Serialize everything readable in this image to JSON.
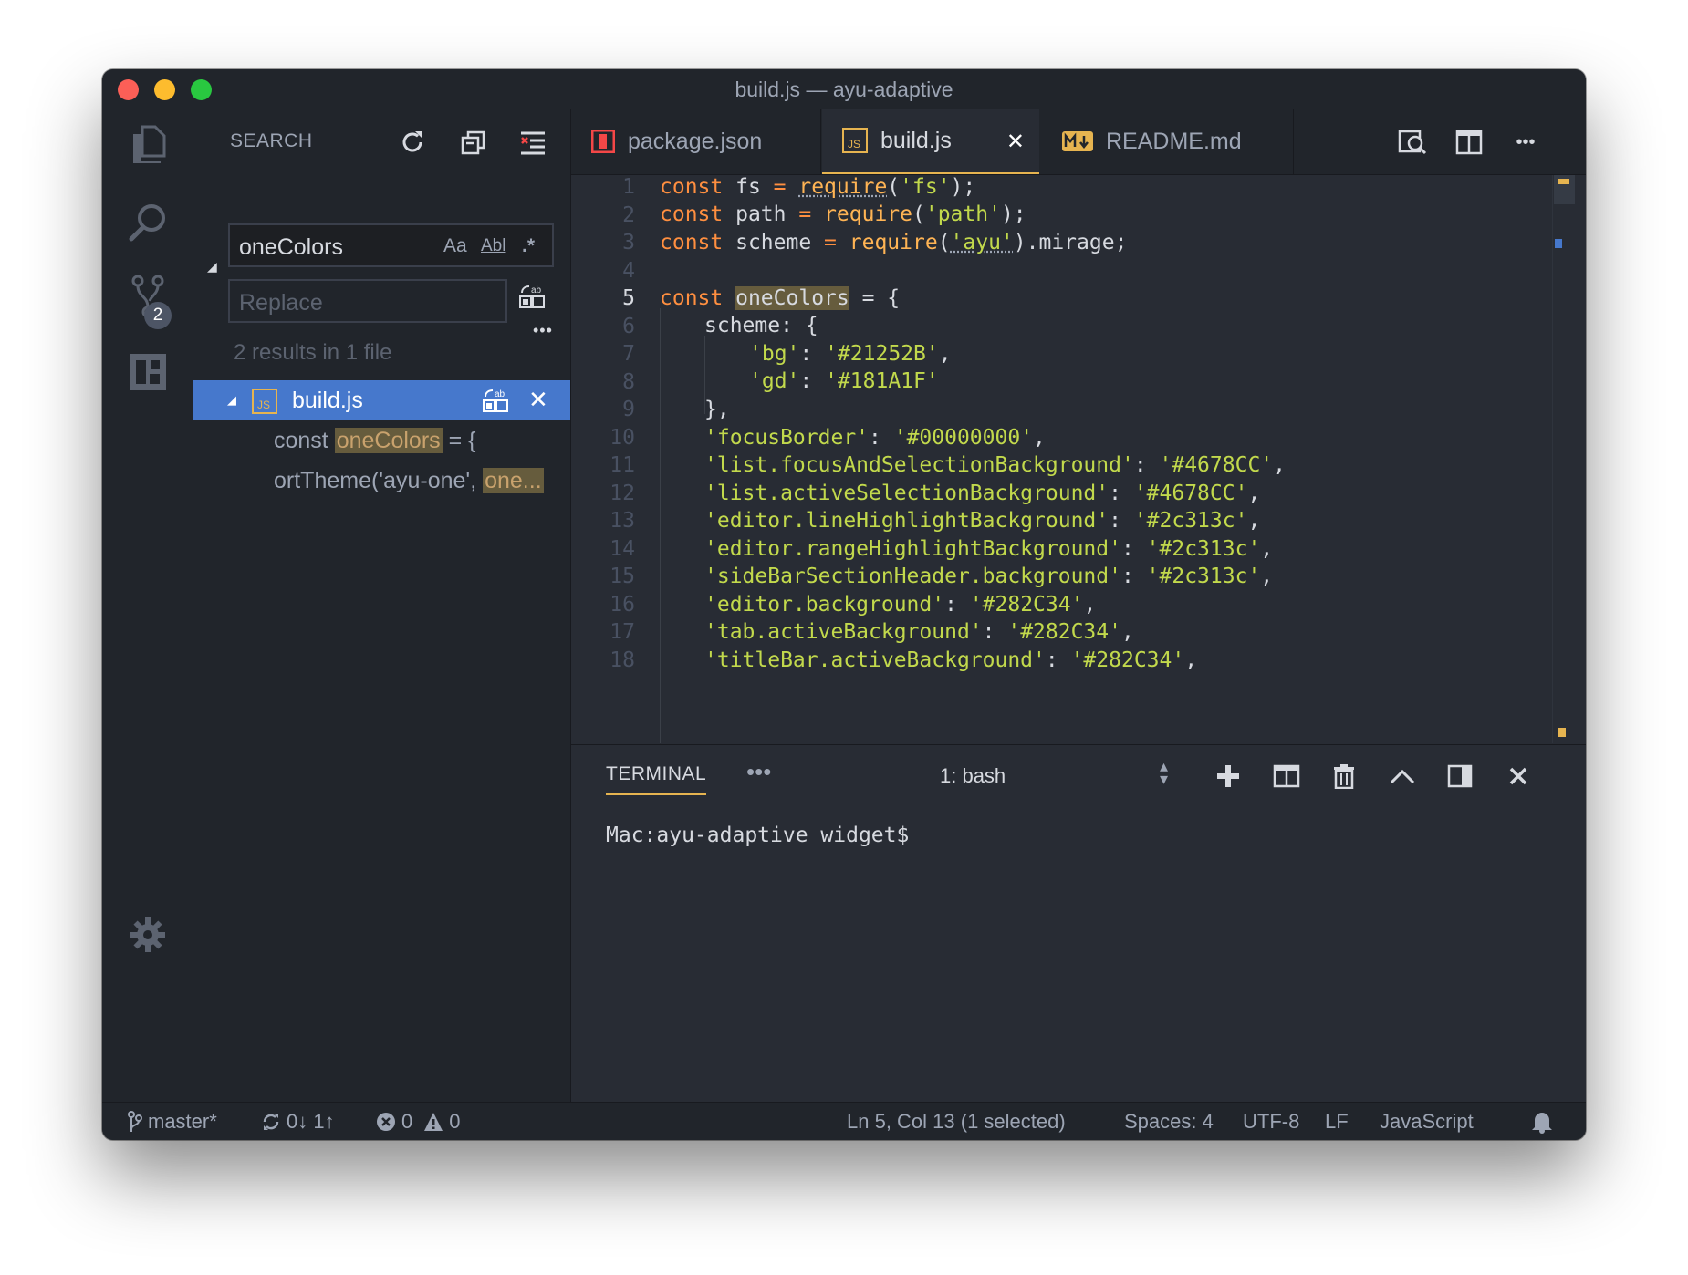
{
  "window": {
    "title": "build.js — ayu-adaptive"
  },
  "activity": {
    "scm_badge": "2"
  },
  "sidebar": {
    "title": "SEARCH",
    "search_value": "oneColors",
    "opt_case": "Aa",
    "opt_word": "Abl",
    "opt_regex": ".*",
    "replace_placeholder": "Replace",
    "results_summary": "2 results in 1 file",
    "file_result": {
      "name": "build.js"
    },
    "matches": [
      {
        "before": "const ",
        "match": "oneColors",
        "after": " = {"
      },
      {
        "before": "ortTheme('ayu-one', ",
        "match": "one...",
        "after": ""
      }
    ]
  },
  "tabs": [
    {
      "label": "package.json",
      "icon": "npm-icon"
    },
    {
      "label": "build.js",
      "icon": "js-icon",
      "close": "✕"
    },
    {
      "label": "README.md",
      "icon": "markdown-icon"
    }
  ],
  "editor": {
    "current_line": 5,
    "line_numbers": [
      "1",
      "2",
      "3",
      "4",
      "5",
      "6",
      "7",
      "8",
      "9",
      "10",
      "11",
      "12",
      "13",
      "14",
      "15",
      "16",
      "17",
      "18"
    ],
    "lines": {
      "l1": {
        "a": "const",
        "b": " fs ",
        "c": "=",
        "d": " ",
        "e": "require",
        "f": "(",
        "g": "'fs'",
        "h": ");"
      },
      "l2": {
        "a": "const",
        "b": " path ",
        "c": "=",
        "d": " ",
        "e": "require",
        "f": "(",
        "g": "'path'",
        "h": ");"
      },
      "l3": {
        "a": "const",
        "b": " scheme ",
        "c": "=",
        "d": " ",
        "e": "require",
        "f": "(",
        "g": "'ayu'",
        "h": ").mirage;"
      },
      "l5": {
        "a": "const",
        "b": " ",
        "sel": "oneColors",
        "c": " = {"
      },
      "l6": {
        "a": "scheme: {"
      },
      "l7": {
        "k": "'bg'",
        "sep": ": ",
        "v": "'#21252B'",
        "end": ","
      },
      "l8": {
        "k": "'gd'",
        "sep": ": ",
        "v": "'#181A1F'",
        "end": ""
      },
      "l9": {
        "a": "},"
      },
      "props": [
        {
          "k": "'focusBorder'",
          "v": "'#00000000'"
        },
        {
          "k": "'list.focusAndSelectionBackground'",
          "v": "'#4678CC'"
        },
        {
          "k": "'list.activeSelectionBackground'",
          "v": "'#4678CC'"
        },
        {
          "k": "'editor.lineHighlightBackground'",
          "v": "'#2c313c'"
        },
        {
          "k": "'editor.rangeHighlightBackground'",
          "v": "'#2c313c'"
        },
        {
          "k": "'sideBarSectionHeader.background'",
          "v": "'#2c313c'"
        },
        {
          "k": "'editor.background'",
          "v": "'#282C34'"
        },
        {
          "k": "'tab.activeBackground'",
          "v": "'#282C34'"
        },
        {
          "k": "'titleBar.activeBackground'",
          "v": "'#282C34'"
        }
      ]
    }
  },
  "panel": {
    "tab": "TERMINAL",
    "more": "•••",
    "terminal_select": "1: bash",
    "prompt": "Mac:ayu-adaptive widget$"
  },
  "statusbar": {
    "branch": "master*",
    "sync": "0↓ 1↑",
    "errors": "0",
    "warnings": "0",
    "cursor": "Ln 5, Col 13 (1 selected)",
    "spaces": "Spaces: 4",
    "encoding": "UTF-8",
    "eol": "LF",
    "language": "JavaScript"
  },
  "colors": {
    "accent": "#e6b450",
    "selection": "#4678cc",
    "keyword": "#ff8f40",
    "function": "#ffb454",
    "string": "#c2d94c",
    "background": "#282c34"
  }
}
